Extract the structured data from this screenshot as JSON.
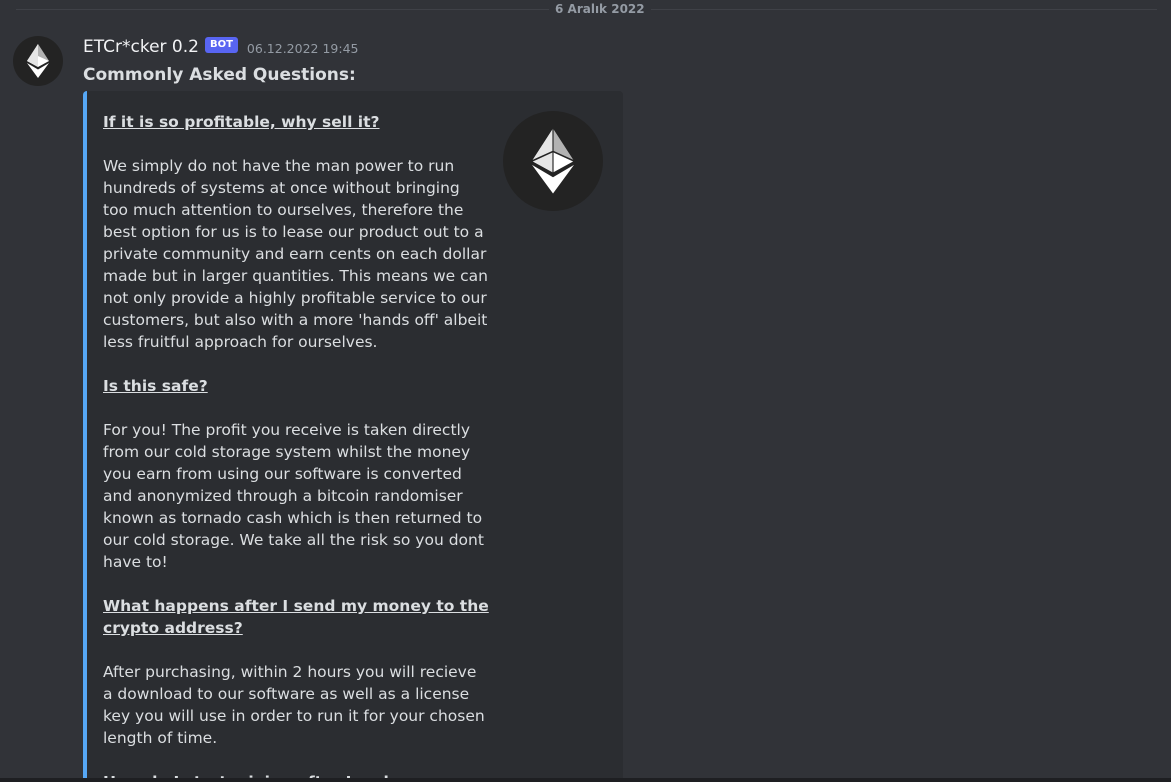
{
  "divider": {
    "date": "6 Aralık 2022"
  },
  "message": {
    "author": "ETCr*cker 0.2",
    "badge": "BOT",
    "timestamp": "06.12.2022 19:45",
    "content": "Commonly Asked Questions:",
    "avatar_icon": "ethereum-logo-icon"
  },
  "embed": {
    "accent_color": "#56a7f5",
    "thumbnail_icon": "ethereum-logo-icon",
    "faq": [
      {
        "question": "If it is so profitable, why sell it?",
        "answer": "We simply do not have the man power to run hundreds of systems at once without bringing too much attention to ourselves, therefore the best option for us is to lease our product out to a private community and earn cents on each dollar made but in larger quantities. This means we can not only provide a highly profitable service to our customers, but also with a more 'hands off' albeit less fruitful approach for ourselves."
      },
      {
        "question": "Is this safe?",
        "answer": "For you! The profit you receive is taken directly from our cold storage system whilst the money you earn from using our software is converted and anonymized through a bitcoin randomiser known as tornado cash which is then returned to our cold storage. We take all the risk so you dont have to!"
      },
      {
        "question": "What happens after I send my money to the crypto address?",
        "answer": "After purchasing, within 2 hours you will recieve a download to our software as well as a license key you will use in order to run it for your chosen length of time."
      },
      {
        "question": "How do I start mining after I make a purchase?",
        "answer": ""
      }
    ]
  }
}
